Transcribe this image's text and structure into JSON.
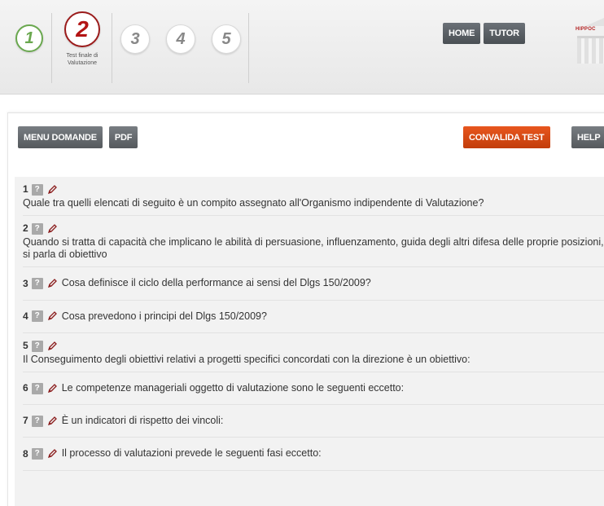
{
  "header": {
    "steps": [
      {
        "number": "1",
        "state": "completed"
      },
      {
        "number": "2",
        "state": "current",
        "caption": "Test finale di Valutazione"
      },
      {
        "number": "3",
        "state": "pending"
      },
      {
        "number": "4",
        "state": "pending"
      },
      {
        "number": "5",
        "state": "pending"
      }
    ],
    "home_label": "HOME",
    "tutor_label": "TUTOR",
    "logo_text": "HIPPOC"
  },
  "toolbar": {
    "menu_label": "MENU DOMANDE",
    "pdf_label": "PDF",
    "validate_label": "CONVALIDA TEST",
    "help_label": "HELP"
  },
  "questions": [
    {
      "number": "1",
      "text": "Quale tra quelli elencati di seguito è un compito assegnato all'Organismo indipendente di Valutazione?",
      "layout": "block"
    },
    {
      "number": "2",
      "text": "Quando si tratta di capacità che implicano le abilità di persuasione, influenzamento, guida degli altri difesa delle proprie posizioni, si parla di obiettivo",
      "layout": "block"
    },
    {
      "number": "3",
      "text": "Cosa definisce il ciclo della performance ai sensi del Dlgs 150/2009?",
      "layout": "inline"
    },
    {
      "number": "4",
      "text": "Cosa prevedono i principi del Dlgs 150/2009?",
      "layout": "inline"
    },
    {
      "number": "5",
      "text": "Il Conseguimento degli obiettivi relativi a progetti specifici concordati con la direzione è un obiettivo:",
      "layout": "block"
    },
    {
      "number": "6",
      "text": "Le competenze manageriali oggetto di valutazione sono le seguenti eccetto:",
      "layout": "inline"
    },
    {
      "number": "7",
      "text": "È un indicatori di rispetto dei vincoli:",
      "layout": "inline"
    },
    {
      "number": "8",
      "text": "Il processo di valutazioni prevede le seguenti fasi eccetto:",
      "layout": "inline"
    }
  ],
  "icons": {
    "help": "?",
    "edit": "pencil-icon"
  },
  "colors": {
    "accent_orange": "#d94a14",
    "current_step": "#b31414",
    "completed_step": "#6aa84f"
  }
}
